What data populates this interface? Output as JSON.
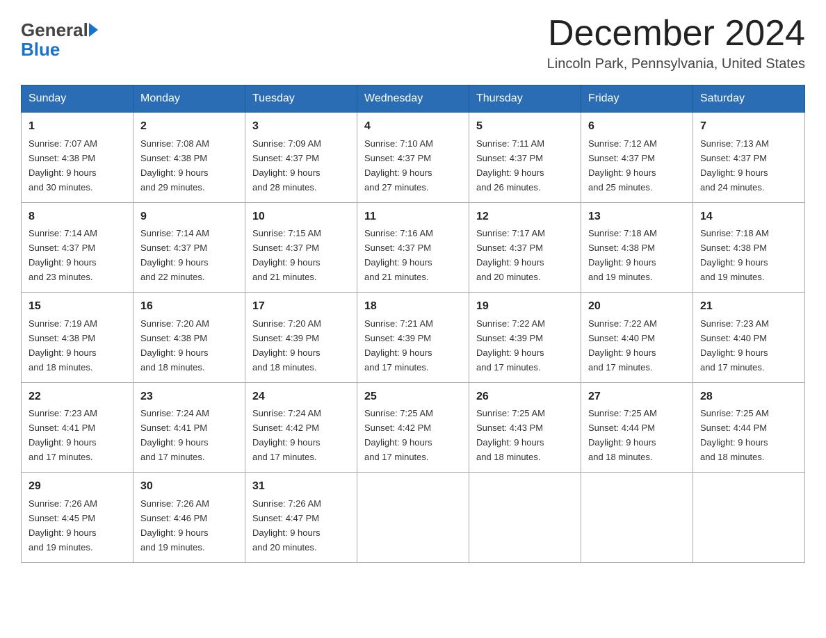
{
  "header": {
    "logo_general": "General",
    "logo_blue": "Blue",
    "month_title": "December 2024",
    "location": "Lincoln Park, Pennsylvania, United States"
  },
  "calendar": {
    "days_of_week": [
      "Sunday",
      "Monday",
      "Tuesday",
      "Wednesday",
      "Thursday",
      "Friday",
      "Saturday"
    ],
    "weeks": [
      [
        {
          "day": "1",
          "sunrise": "7:07 AM",
          "sunset": "4:38 PM",
          "daylight": "9 hours and 30 minutes."
        },
        {
          "day": "2",
          "sunrise": "7:08 AM",
          "sunset": "4:38 PM",
          "daylight": "9 hours and 29 minutes."
        },
        {
          "day": "3",
          "sunrise": "7:09 AM",
          "sunset": "4:37 PM",
          "daylight": "9 hours and 28 minutes."
        },
        {
          "day": "4",
          "sunrise": "7:10 AM",
          "sunset": "4:37 PM",
          "daylight": "9 hours and 27 minutes."
        },
        {
          "day": "5",
          "sunrise": "7:11 AM",
          "sunset": "4:37 PM",
          "daylight": "9 hours and 26 minutes."
        },
        {
          "day": "6",
          "sunrise": "7:12 AM",
          "sunset": "4:37 PM",
          "daylight": "9 hours and 25 minutes."
        },
        {
          "day": "7",
          "sunrise": "7:13 AM",
          "sunset": "4:37 PM",
          "daylight": "9 hours and 24 minutes."
        }
      ],
      [
        {
          "day": "8",
          "sunrise": "7:14 AM",
          "sunset": "4:37 PM",
          "daylight": "9 hours and 23 minutes."
        },
        {
          "day": "9",
          "sunrise": "7:14 AM",
          "sunset": "4:37 PM",
          "daylight": "9 hours and 22 minutes."
        },
        {
          "day": "10",
          "sunrise": "7:15 AM",
          "sunset": "4:37 PM",
          "daylight": "9 hours and 21 minutes."
        },
        {
          "day": "11",
          "sunrise": "7:16 AM",
          "sunset": "4:37 PM",
          "daylight": "9 hours and 21 minutes."
        },
        {
          "day": "12",
          "sunrise": "7:17 AM",
          "sunset": "4:37 PM",
          "daylight": "9 hours and 20 minutes."
        },
        {
          "day": "13",
          "sunrise": "7:18 AM",
          "sunset": "4:38 PM",
          "daylight": "9 hours and 19 minutes."
        },
        {
          "day": "14",
          "sunrise": "7:18 AM",
          "sunset": "4:38 PM",
          "daylight": "9 hours and 19 minutes."
        }
      ],
      [
        {
          "day": "15",
          "sunrise": "7:19 AM",
          "sunset": "4:38 PM",
          "daylight": "9 hours and 18 minutes."
        },
        {
          "day": "16",
          "sunrise": "7:20 AM",
          "sunset": "4:38 PM",
          "daylight": "9 hours and 18 minutes."
        },
        {
          "day": "17",
          "sunrise": "7:20 AM",
          "sunset": "4:39 PM",
          "daylight": "9 hours and 18 minutes."
        },
        {
          "day": "18",
          "sunrise": "7:21 AM",
          "sunset": "4:39 PM",
          "daylight": "9 hours and 17 minutes."
        },
        {
          "day": "19",
          "sunrise": "7:22 AM",
          "sunset": "4:39 PM",
          "daylight": "9 hours and 17 minutes."
        },
        {
          "day": "20",
          "sunrise": "7:22 AM",
          "sunset": "4:40 PM",
          "daylight": "9 hours and 17 minutes."
        },
        {
          "day": "21",
          "sunrise": "7:23 AM",
          "sunset": "4:40 PM",
          "daylight": "9 hours and 17 minutes."
        }
      ],
      [
        {
          "day": "22",
          "sunrise": "7:23 AM",
          "sunset": "4:41 PM",
          "daylight": "9 hours and 17 minutes."
        },
        {
          "day": "23",
          "sunrise": "7:24 AM",
          "sunset": "4:41 PM",
          "daylight": "9 hours and 17 minutes."
        },
        {
          "day": "24",
          "sunrise": "7:24 AM",
          "sunset": "4:42 PM",
          "daylight": "9 hours and 17 minutes."
        },
        {
          "day": "25",
          "sunrise": "7:25 AM",
          "sunset": "4:42 PM",
          "daylight": "9 hours and 17 minutes."
        },
        {
          "day": "26",
          "sunrise": "7:25 AM",
          "sunset": "4:43 PM",
          "daylight": "9 hours and 18 minutes."
        },
        {
          "day": "27",
          "sunrise": "7:25 AM",
          "sunset": "4:44 PM",
          "daylight": "9 hours and 18 minutes."
        },
        {
          "day": "28",
          "sunrise": "7:25 AM",
          "sunset": "4:44 PM",
          "daylight": "9 hours and 18 minutes."
        }
      ],
      [
        {
          "day": "29",
          "sunrise": "7:26 AM",
          "sunset": "4:45 PM",
          "daylight": "9 hours and 19 minutes."
        },
        {
          "day": "30",
          "sunrise": "7:26 AM",
          "sunset": "4:46 PM",
          "daylight": "9 hours and 19 minutes."
        },
        {
          "day": "31",
          "sunrise": "7:26 AM",
          "sunset": "4:47 PM",
          "daylight": "9 hours and 20 minutes."
        },
        null,
        null,
        null,
        null
      ]
    ],
    "sunrise_label": "Sunrise:",
    "sunset_label": "Sunset:",
    "daylight_label": "Daylight:"
  }
}
